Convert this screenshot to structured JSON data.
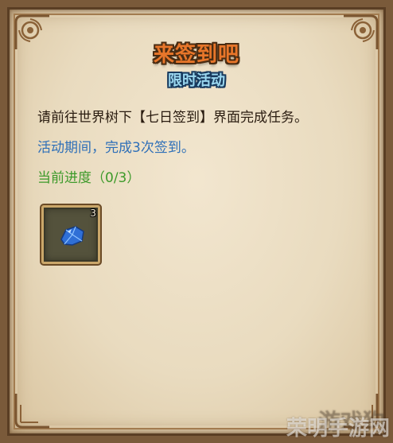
{
  "dialog": {
    "title": "来签到吧",
    "subtitle": "限时活动",
    "description": "请前往世界树下【七日签到】界面完成任务。",
    "period": "活动期间，完成3次签到。",
    "progress": "当前进度（0/3）"
  },
  "reward": {
    "icon": "blue-crystal-icon",
    "count": "3"
  },
  "watermark": {
    "text_back": "游戏狗",
    "text_front": "荣明手游网"
  },
  "colors": {
    "title": "#e8762a",
    "subtitle": "#9bd8f0",
    "description": "#2a1c10",
    "period": "#2e6fb8",
    "progress": "#3d9a2a",
    "parchment": "#e9dbbf"
  }
}
